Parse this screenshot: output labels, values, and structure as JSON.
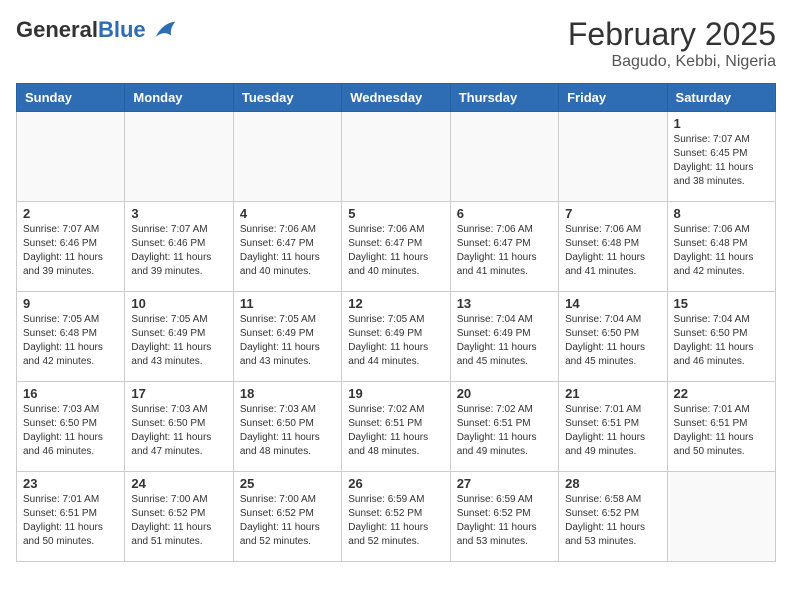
{
  "header": {
    "logo_general": "General",
    "logo_blue": "Blue",
    "month_year": "February 2025",
    "location": "Bagudo, Kebbi, Nigeria"
  },
  "weekdays": [
    "Sunday",
    "Monday",
    "Tuesday",
    "Wednesday",
    "Thursday",
    "Friday",
    "Saturday"
  ],
  "weeks": [
    [
      {
        "day": "",
        "info": ""
      },
      {
        "day": "",
        "info": ""
      },
      {
        "day": "",
        "info": ""
      },
      {
        "day": "",
        "info": ""
      },
      {
        "day": "",
        "info": ""
      },
      {
        "day": "",
        "info": ""
      },
      {
        "day": "1",
        "info": "Sunrise: 7:07 AM\nSunset: 6:45 PM\nDaylight: 11 hours\nand 38 minutes."
      }
    ],
    [
      {
        "day": "2",
        "info": "Sunrise: 7:07 AM\nSunset: 6:46 PM\nDaylight: 11 hours\nand 39 minutes."
      },
      {
        "day": "3",
        "info": "Sunrise: 7:07 AM\nSunset: 6:46 PM\nDaylight: 11 hours\nand 39 minutes."
      },
      {
        "day": "4",
        "info": "Sunrise: 7:06 AM\nSunset: 6:47 PM\nDaylight: 11 hours\nand 40 minutes."
      },
      {
        "day": "5",
        "info": "Sunrise: 7:06 AM\nSunset: 6:47 PM\nDaylight: 11 hours\nand 40 minutes."
      },
      {
        "day": "6",
        "info": "Sunrise: 7:06 AM\nSunset: 6:47 PM\nDaylight: 11 hours\nand 41 minutes."
      },
      {
        "day": "7",
        "info": "Sunrise: 7:06 AM\nSunset: 6:48 PM\nDaylight: 11 hours\nand 41 minutes."
      },
      {
        "day": "8",
        "info": "Sunrise: 7:06 AM\nSunset: 6:48 PM\nDaylight: 11 hours\nand 42 minutes."
      }
    ],
    [
      {
        "day": "9",
        "info": "Sunrise: 7:05 AM\nSunset: 6:48 PM\nDaylight: 11 hours\nand 42 minutes."
      },
      {
        "day": "10",
        "info": "Sunrise: 7:05 AM\nSunset: 6:49 PM\nDaylight: 11 hours\nand 43 minutes."
      },
      {
        "day": "11",
        "info": "Sunrise: 7:05 AM\nSunset: 6:49 PM\nDaylight: 11 hours\nand 43 minutes."
      },
      {
        "day": "12",
        "info": "Sunrise: 7:05 AM\nSunset: 6:49 PM\nDaylight: 11 hours\nand 44 minutes."
      },
      {
        "day": "13",
        "info": "Sunrise: 7:04 AM\nSunset: 6:49 PM\nDaylight: 11 hours\nand 45 minutes."
      },
      {
        "day": "14",
        "info": "Sunrise: 7:04 AM\nSunset: 6:50 PM\nDaylight: 11 hours\nand 45 minutes."
      },
      {
        "day": "15",
        "info": "Sunrise: 7:04 AM\nSunset: 6:50 PM\nDaylight: 11 hours\nand 46 minutes."
      }
    ],
    [
      {
        "day": "16",
        "info": "Sunrise: 7:03 AM\nSunset: 6:50 PM\nDaylight: 11 hours\nand 46 minutes."
      },
      {
        "day": "17",
        "info": "Sunrise: 7:03 AM\nSunset: 6:50 PM\nDaylight: 11 hours\nand 47 minutes."
      },
      {
        "day": "18",
        "info": "Sunrise: 7:03 AM\nSunset: 6:50 PM\nDaylight: 11 hours\nand 48 minutes."
      },
      {
        "day": "19",
        "info": "Sunrise: 7:02 AM\nSunset: 6:51 PM\nDaylight: 11 hours\nand 48 minutes."
      },
      {
        "day": "20",
        "info": "Sunrise: 7:02 AM\nSunset: 6:51 PM\nDaylight: 11 hours\nand 49 minutes."
      },
      {
        "day": "21",
        "info": "Sunrise: 7:01 AM\nSunset: 6:51 PM\nDaylight: 11 hours\nand 49 minutes."
      },
      {
        "day": "22",
        "info": "Sunrise: 7:01 AM\nSunset: 6:51 PM\nDaylight: 11 hours\nand 50 minutes."
      }
    ],
    [
      {
        "day": "23",
        "info": "Sunrise: 7:01 AM\nSunset: 6:51 PM\nDaylight: 11 hours\nand 50 minutes."
      },
      {
        "day": "24",
        "info": "Sunrise: 7:00 AM\nSunset: 6:52 PM\nDaylight: 11 hours\nand 51 minutes."
      },
      {
        "day": "25",
        "info": "Sunrise: 7:00 AM\nSunset: 6:52 PM\nDaylight: 11 hours\nand 52 minutes."
      },
      {
        "day": "26",
        "info": "Sunrise: 6:59 AM\nSunset: 6:52 PM\nDaylight: 11 hours\nand 52 minutes."
      },
      {
        "day": "27",
        "info": "Sunrise: 6:59 AM\nSunset: 6:52 PM\nDaylight: 11 hours\nand 53 minutes."
      },
      {
        "day": "28",
        "info": "Sunrise: 6:58 AM\nSunset: 6:52 PM\nDaylight: 11 hours\nand 53 minutes."
      },
      {
        "day": "",
        "info": ""
      }
    ]
  ]
}
